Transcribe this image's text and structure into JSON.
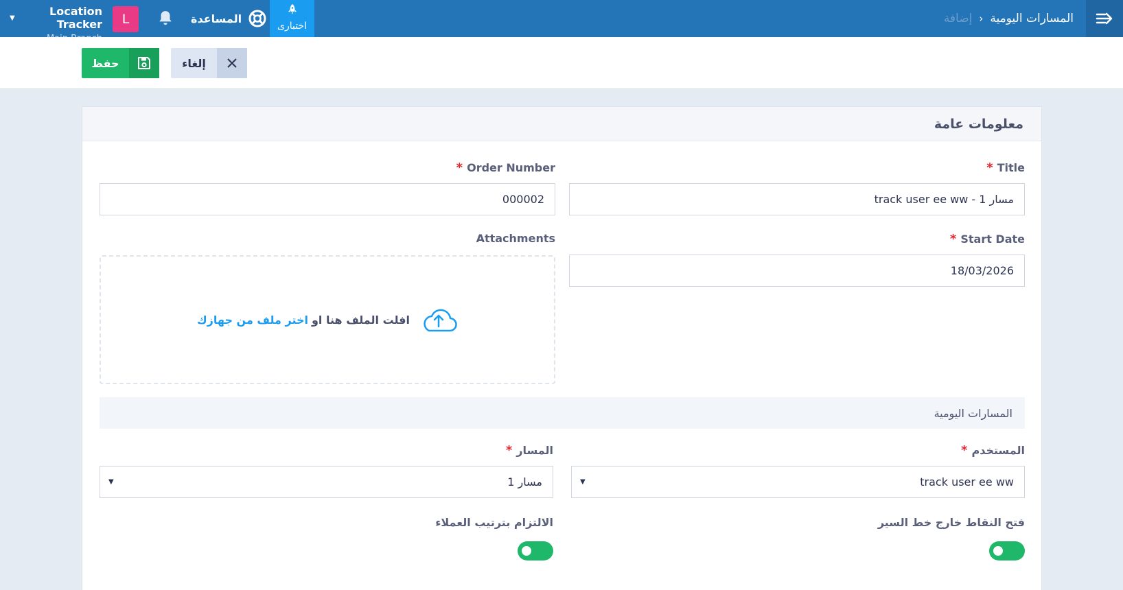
{
  "header": {
    "breadcrumb": {
      "parent": "المسارات اليومية",
      "separator": "›",
      "current": "إضافة"
    },
    "brand": {
      "name": "Location Tracker",
      "branch": "Main Branch"
    },
    "avatar_letter": "L",
    "help_label": "المساعدة",
    "trial_label": "اختبارى"
  },
  "toolbar": {
    "save_label": "حفظ",
    "cancel_label": "إلغاء"
  },
  "panel": {
    "title": "معلومات عامة",
    "fields": {
      "title": {
        "label": "Title",
        "value": "track user ee ww - مسار 1"
      },
      "order_number": {
        "label": "Order Number",
        "value": "000002"
      },
      "start_date": {
        "label": "Start Date",
        "value": "18/03/2026"
      },
      "attachments": {
        "label": "Attachments",
        "drop_text": "افلت الملف هنا او",
        "choose_link": "اختر ملف من جهازك"
      }
    },
    "required_marker": "*",
    "daily_routes": {
      "title": "المسارات اليومية",
      "user": {
        "label": "المستخدم",
        "value": "track user ee ww"
      },
      "route": {
        "label": "المسار",
        "value": "مسار 1"
      },
      "open_points_toggle": {
        "label": "فتح النقاط خارج خط السير",
        "on": true
      },
      "customer_order_toggle": {
        "label": "الالتزام بترتيب العملاء",
        "on": true
      }
    }
  },
  "colors": {
    "topbar": "#2474b8",
    "save": "#1fb86a",
    "accent_link": "#1a9df0",
    "required": "#e3262d",
    "avatar": "#e93a86"
  }
}
